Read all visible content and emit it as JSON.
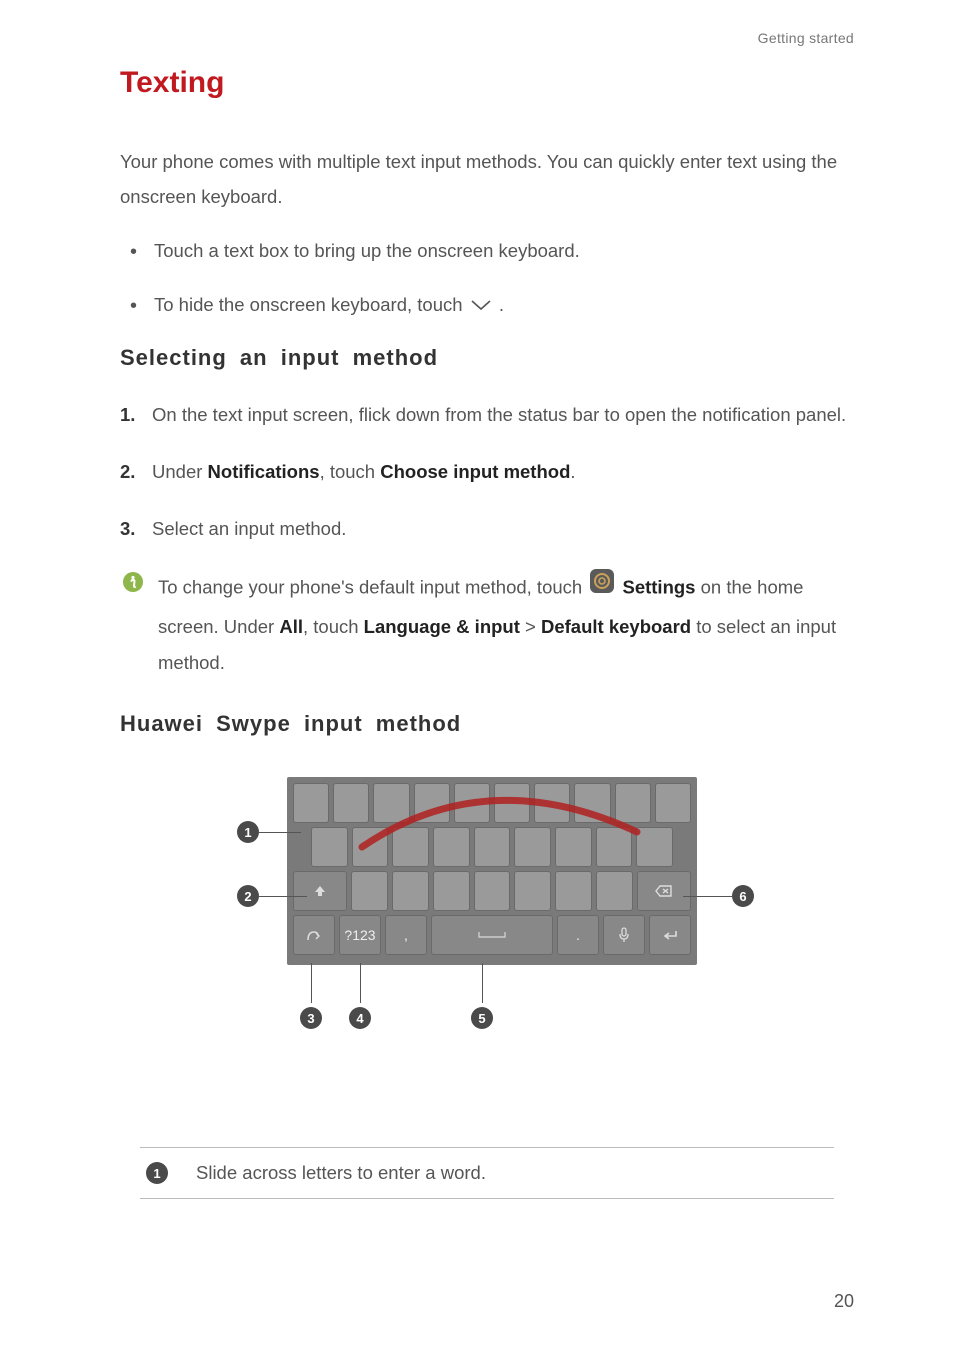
{
  "header": {
    "running": "Getting started"
  },
  "title": "Texting",
  "intro": "Your phone comes with multiple text input methods. You can quickly enter text using the onscreen keyboard.",
  "bullets": {
    "b1": "Touch a text box to bring up the onscreen keyboard.",
    "b2_pre": "To hide the onscreen keyboard, touch ",
    "b2_post": "."
  },
  "sect1": {
    "heading": "Selecting an input method",
    "steps": {
      "s1": "On the text input screen, flick down from the status bar to open the notification panel.",
      "s2_pre": "Under ",
      "s2_b1": "Notifications",
      "s2_mid": ", touch ",
      "s2_b2": "Choose input method",
      "s2_post": ".",
      "s3": "Select an input method."
    },
    "tip": {
      "t_pre": "To change your phone's default input method, touch ",
      "t_settings": "Settings",
      "t_mid1": " on the home screen. Under ",
      "t_all": "All",
      "t_mid2": ", touch ",
      "t_lang": "Language & input",
      "t_gt": " > ",
      "t_def": "Default keyboard",
      "t_post": " to select an input method."
    }
  },
  "sect2": {
    "heading": "Huawei Swype input method"
  },
  "keyboard": {
    "callouts": {
      "c1": "1",
      "c2": "2",
      "c3": "3",
      "c4": "4",
      "c5": "5",
      "c6": "6"
    },
    "keys": {
      "num": "?123"
    }
  },
  "legend": {
    "n1": "1",
    "t1": "Slide across letters to enter a word."
  },
  "page_number": "20"
}
